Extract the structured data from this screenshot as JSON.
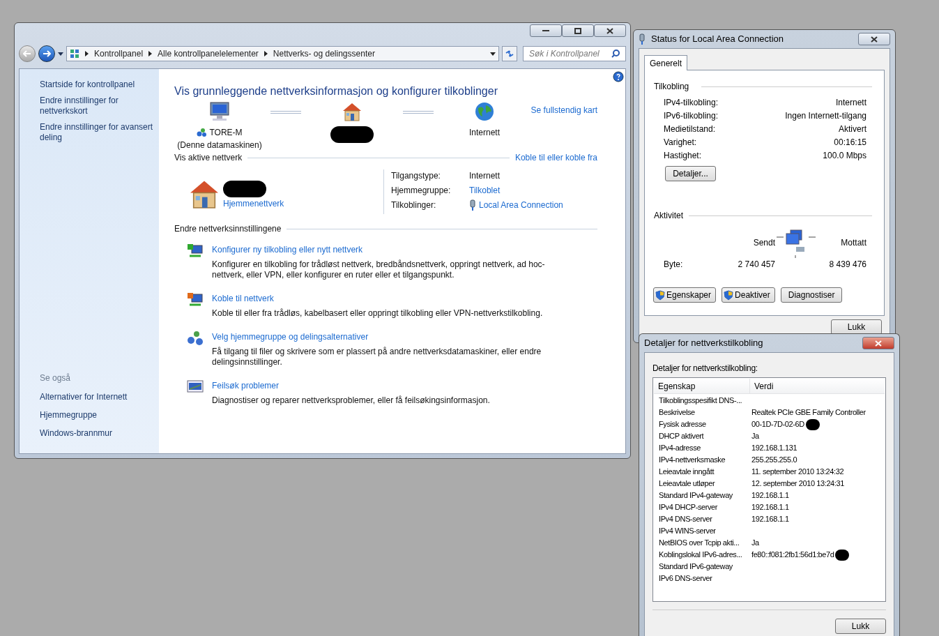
{
  "main_window": {
    "address": {
      "crumbs": [
        "Kontrollpanel",
        "Alle kontrollpanelelementer",
        "Nettverks- og delingssenter"
      ],
      "search": {
        "placeholder": "Søk i Kontrollpanel"
      }
    },
    "sidebar": {
      "items": [
        "Startside for kontrollpanel",
        "Endre innstillinger for nettverkskort",
        "Endre innstillinger for avansert deling"
      ],
      "see_also": {
        "title": "Se også",
        "items": [
          "Alternativer for Internett",
          "Hjemmegruppe",
          "Windows-brannmur"
        ]
      }
    },
    "content": {
      "title": "Vis grunnleggende nettverksinformasjon og konfigurer tilkoblinger",
      "full_map_link": "Se fullstendig kart",
      "map": [
        {
          "kind": "computer",
          "label": "TORE-M",
          "sublabel": "(Denne datamaskinen)",
          "redacted": false
        },
        {
          "kind": "home",
          "redacted": true
        },
        {
          "kind": "globe",
          "label": "Internett",
          "redacted": false
        }
      ],
      "active_networks": {
        "title": "Vis aktive nettverk",
        "link": "Koble til eller koble fra",
        "network_type": "Hjemmenettverk",
        "redacted": true,
        "details": [
          {
            "label": "Tilgangstype:",
            "value": "Internett",
            "kind": "text"
          },
          {
            "label": "Hjemmegruppe:",
            "value": "Tilkoblet",
            "kind": "link"
          },
          {
            "label": "Tilkoblinger:",
            "value": "Local Area Connection",
            "kind": "connection"
          }
        ]
      },
      "settings": {
        "title": "Endre nettverksinnstillingene",
        "tasks": [
          {
            "kind": "new",
            "title": "Konfigurer ny tilkobling eller nytt nettverk",
            "description": "Konfigurer en tilkobling for trådløst nettverk, bredbåndsnettverk, oppringt nettverk, ad hoc-nettverk, eller VPN, eller konfigurer en ruter eller et tilgangspunkt."
          },
          {
            "kind": "connect",
            "title": "Koble til nettverk",
            "description": "Koble til eller fra trådløs, kabelbasert eller oppringt tilkobling eller VPN-nettverkstilkobling."
          },
          {
            "kind": "homegroup",
            "title": "Velg hjemmegruppe og delingsalternativer",
            "description": "Få tilgang til filer og skrivere som er plassert på andre nettverksdatamaskiner, eller endre delingsinnstillinger."
          },
          {
            "kind": "troubleshoot",
            "title": "Feilsøk problemer",
            "description": "Diagnostiser og reparer nettverksproblemer, eller få feilsøkingsinformasjon."
          }
        ]
      }
    }
  },
  "status_window": {
    "title": "Status for Local Area Connection",
    "tabs": [
      {
        "label": "Generelt",
        "selected": true
      }
    ],
    "connection": {
      "title": "Tilkobling",
      "rows": [
        {
          "label": "IPv4-tilkobling:",
          "value": "Internett"
        },
        {
          "label": "IPv6-tilkobling:",
          "value": "Ingen Internett-tilgang"
        },
        {
          "label": "Medietilstand:",
          "value": "Aktivert"
        },
        {
          "label": "Varighet:",
          "value": "00:16:15"
        },
        {
          "label": "Hastighet:",
          "value": "100.0 Mbps"
        }
      ],
      "details_button": "Detaljer..."
    },
    "activity": {
      "title": "Aktivitet",
      "sent_label": "Sendt",
      "received_label": "Mottatt",
      "bytes_label": "Byte:",
      "sent": "2 740 457",
      "received": "8 439 476"
    },
    "buttons": [
      {
        "label": "Egenskaper",
        "shield": true
      },
      {
        "label": "Deaktiver",
        "shield": true
      },
      {
        "label": "Diagnostiser",
        "shield": false
      }
    ],
    "close_button": "Lukk"
  },
  "details_window": {
    "title": "Detaljer for nettverkstilkobling",
    "caption": "Detaljer for nettverkstilkobling:",
    "columns": [
      "Egenskap",
      "Verdi"
    ],
    "rows": [
      {
        "property": "Tilkoblingsspesifikt DNS-...",
        "value": "",
        "redacted": false
      },
      {
        "property": "Beskrivelse",
        "value": "Realtek PCIe GBE Family Controller",
        "redacted": false
      },
      {
        "property": "Fysisk adresse",
        "value": "00-1D-7D-02-6D",
        "redacted": true
      },
      {
        "property": "DHCP aktivert",
        "value": "Ja",
        "redacted": false
      },
      {
        "property": "IPv4-adresse",
        "value": "192.168.1.131",
        "redacted": false
      },
      {
        "property": "IPv4-nettverksmaske",
        "value": "255.255.255.0",
        "redacted": false
      },
      {
        "property": "Leieavtale inngått",
        "value": "11. september 2010 13:24:32",
        "redacted": false
      },
      {
        "property": "Leieavtale utløper",
        "value": "12. september 2010 13:24:31",
        "redacted": false
      },
      {
        "property": "Standard IPv4-gateway",
        "value": "192.168.1.1",
        "redacted": false
      },
      {
        "property": "IPv4 DHCP-server",
        "value": "192.168.1.1",
        "redacted": false
      },
      {
        "property": "IPv4 DNS-server",
        "value": "192.168.1.1",
        "redacted": false
      },
      {
        "property": "IPv4 WINS-server",
        "value": "",
        "redacted": false
      },
      {
        "property": "NetBIOS over Tcpip akti...",
        "value": "Ja",
        "redacted": false
      },
      {
        "property": "Koblingslokal IPv6-adres...",
        "value": "fe80::f081:2fb1:56d1:be7d",
        "redacted": true
      },
      {
        "property": "Standard IPv6-gateway",
        "value": "",
        "redacted": false
      },
      {
        "property": "IPv6 DNS-server",
        "value": "",
        "redacted": false
      }
    ],
    "close_button": "Lukk"
  }
}
